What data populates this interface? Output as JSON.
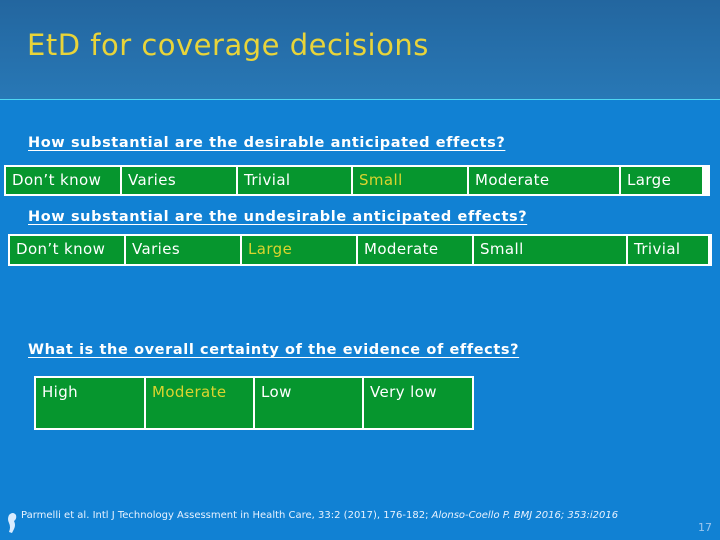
{
  "slide": {
    "title": "EtD for coverage decisions",
    "page_number": "17"
  },
  "sections": [
    {
      "question": "How substantial are the desirable anticipated effects?",
      "options": [
        {
          "label": "Don’t know",
          "selected": false
        },
        {
          "label": "Varies",
          "selected": false
        },
        {
          "label": "Trivial",
          "selected": false
        },
        {
          "label": "Small",
          "selected": true
        },
        {
          "label": "Moderate",
          "selected": false
        },
        {
          "label": "Large",
          "selected": false
        }
      ]
    },
    {
      "question": "How substantial are the undesirable anticipated effects?",
      "options": [
        {
          "label": "Don’t know",
          "selected": false
        },
        {
          "label": "Varies",
          "selected": false
        },
        {
          "label": "Large",
          "selected": true
        },
        {
          "label": "Moderate",
          "selected": false
        },
        {
          "label": "Small",
          "selected": false
        },
        {
          "label": "Trivial",
          "selected": false
        }
      ]
    },
    {
      "question": "What is the overall certainty of the evidence of effects?",
      "options": [
        {
          "label": "High",
          "selected": false
        },
        {
          "label": "Moderate",
          "selected": true
        },
        {
          "label": "Low",
          "selected": false
        },
        {
          "label": "Very low",
          "selected": false
        }
      ]
    }
  ],
  "footer": {
    "citation_1": "Parmelli et al. Intl J Technology Assessment in Health Care, 33:2 (2017), 176-182; ",
    "citation_2": "Alonso-Coello P. BMJ 2016; 353:i2016"
  },
  "colors": {
    "background": "#1181d3",
    "cell_fill": "#06962e",
    "selected_text": "#dad42e",
    "title_text": "#e8d43a"
  }
}
